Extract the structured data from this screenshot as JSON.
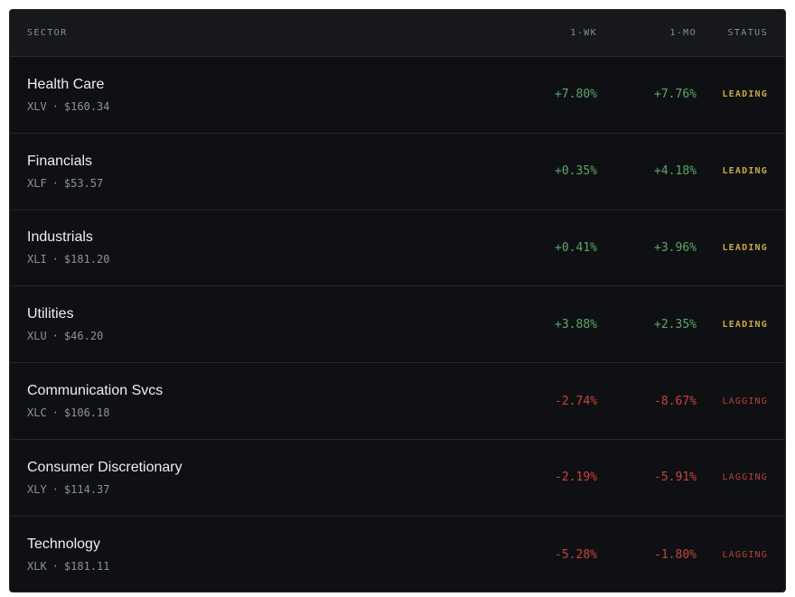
{
  "header": {
    "sector": "SECTOR",
    "week": "1-WK",
    "month": "1-MO",
    "status": "STATUS"
  },
  "rows": [
    {
      "name": "Health Care",
      "ticker": "XLV",
      "sep": "·",
      "price": "$160.34",
      "wk": "+7.80%",
      "mo": "+7.76%",
      "status": "LEADING"
    },
    {
      "name": "Financials",
      "ticker": "XLF",
      "sep": "·",
      "price": "$53.57",
      "wk": "+0.35%",
      "mo": "+4.18%",
      "status": "LEADING"
    },
    {
      "name": "Industrials",
      "ticker": "XLI",
      "sep": "·",
      "price": "$181.20",
      "wk": "+0.41%",
      "mo": "+3.96%",
      "status": "LEADING"
    },
    {
      "name": "Utilities",
      "ticker": "XLU",
      "sep": "·",
      "price": "$46.20",
      "wk": "+3.88%",
      "mo": "+2.35%",
      "status": "LEADING"
    },
    {
      "name": "Communication Svcs",
      "ticker": "XLC",
      "sep": "·",
      "price": "$106.18",
      "wk": "-2.74%",
      "mo": "-8.67%",
      "status": "LAGGING"
    },
    {
      "name": "Consumer Discretionary",
      "ticker": "XLY",
      "sep": "·",
      "price": "$114.37",
      "wk": "-2.19%",
      "mo": "-5.91%",
      "status": "LAGGING"
    },
    {
      "name": "Technology",
      "ticker": "XLK",
      "sep": "·",
      "price": "$181.11",
      "wk": "-5.28%",
      "mo": "-1.80%",
      "status": "LAGGING"
    }
  ],
  "colors": {
    "positive": "#5aa86a",
    "negative": "#c9433e",
    "leading": "#c9a84a",
    "lagging": "#b8413c",
    "background": "#0f1013"
  }
}
